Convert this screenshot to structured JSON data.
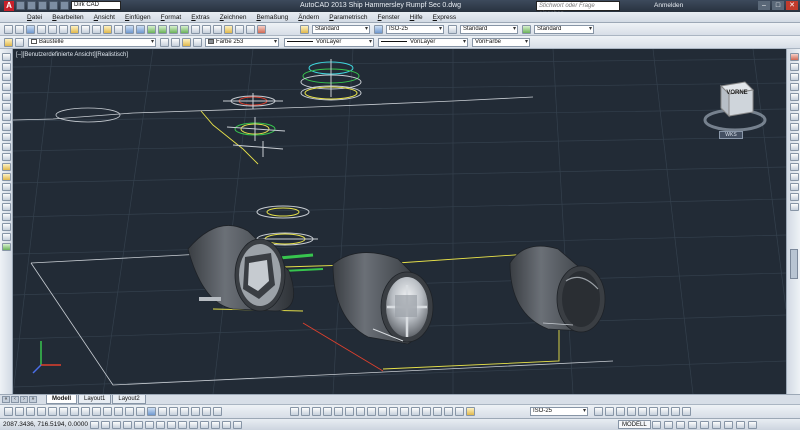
{
  "titlebar": {
    "workspace": "Dirk CAD",
    "title": "AutoCAD 2013   Ship Hammersley Rumpf Sec 0.dwg",
    "search_placeholder": "Stichwort oder Frage eingeben",
    "login": "Anmelden",
    "min": "–",
    "max": "□",
    "close": "✕"
  },
  "menu": [
    "Datei",
    "Bearbeiten",
    "Ansicht",
    "Einfügen",
    "Format",
    "Extras",
    "Zeichnen",
    "Bemaßung",
    "Ändern",
    "Parametrisch",
    "Fenster",
    "Hilfe",
    "Express"
  ],
  "styles": {
    "text_style": "Standard",
    "dim_style": "ISO-25",
    "table_style": "Standard",
    "multileader_style": "Standard"
  },
  "layer": {
    "name": "Baustelle",
    "color": "Farbe 253",
    "linetype": "VonLayer",
    "lineweight": "VonLayer",
    "plotstyle": "VonFarbe"
  },
  "viewport": {
    "label": "[–][Benutzerdefinierte Ansicht][Realistisch]",
    "viewcube_face": "VORNE",
    "wcs": "WKS"
  },
  "tabs": [
    "Modell",
    "Layout1",
    "Layout2"
  ],
  "bottom": {
    "dim_style": "ISO-25"
  },
  "status": {
    "coords": "2087.3436, 716.5194, 0.0000",
    "mode": "MODELL"
  },
  "colors": {
    "viewport_bg": "#222b36",
    "grid": "#34404d",
    "yellow": "#e8e24a",
    "green": "#37c54e",
    "cyan": "#3fd7de",
    "red": "#e0402d"
  }
}
